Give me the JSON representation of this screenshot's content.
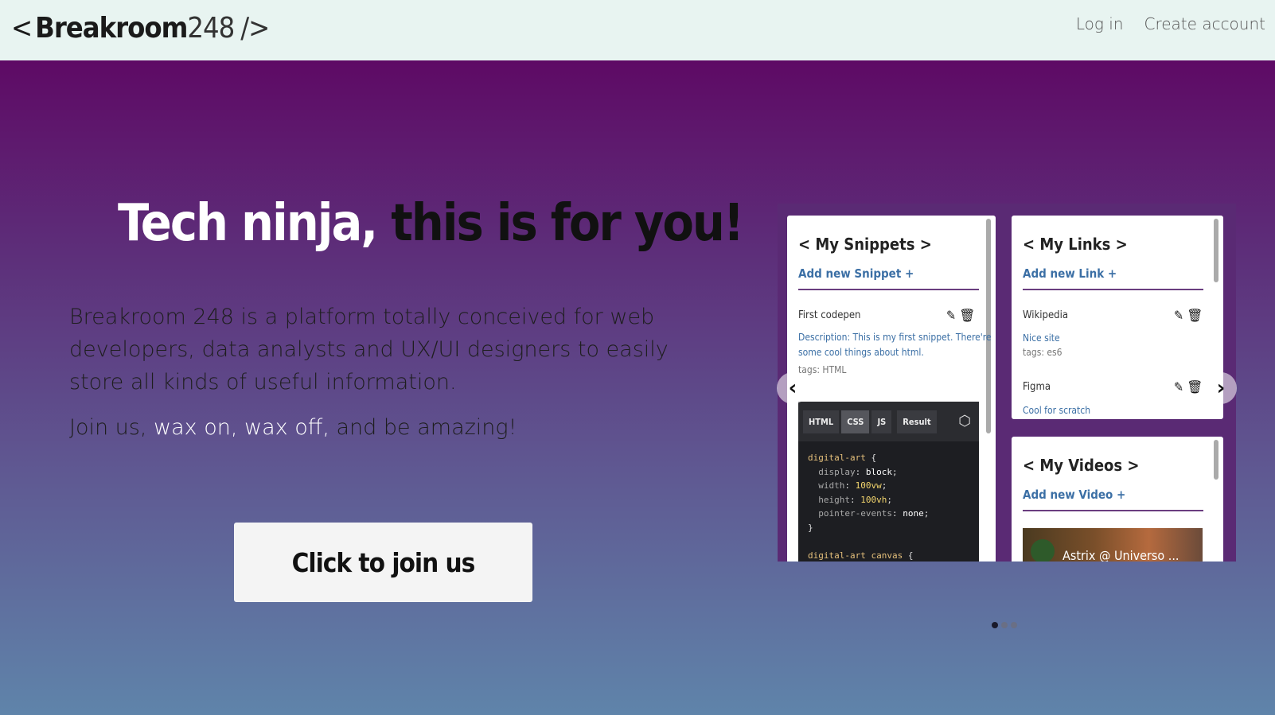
{
  "header": {
    "logo_open": "<",
    "logo_brand": "Breakroom",
    "logo_num": "248",
    "logo_close": "/>",
    "nav": {
      "login": "Log in",
      "create": "Create account"
    }
  },
  "hero": {
    "headline_white": "Tech ninja,",
    "headline_dark": "this is for you!",
    "description": "Breakroom 248 is a platform totally conceived for web developers, data analysts and UX/UI designers to easily store all kinds of useful information.",
    "slogan_1": "Join us, ",
    "slogan_hl": "wax on, wax off,",
    "slogan_2": " and be amazing!",
    "cta": "Click to join us"
  },
  "carousel": {
    "prev": "‹",
    "next": "›",
    "slides_count": 3,
    "active_slide": 1,
    "snippets": {
      "title": "< My Snippets >",
      "add": "Add new Snippet +",
      "item_title": "First codepen",
      "item_desc_1": "Description: This is my first snippet. There're",
      "item_desc_2": "some cool things about html.",
      "item_tags": "tags: HTML",
      "tabs": [
        "HTML",
        "CSS",
        "JS",
        "Result"
      ]
    },
    "links": {
      "title": "< My Links >",
      "add": "Add new Link +",
      "item1_title": "Wikipedia",
      "item1_desc": "Nice site",
      "item1_tags": "tags: es6",
      "item2_title": "Figma",
      "item2_desc": "Cool for scratch"
    },
    "videos": {
      "title": "< My Videos >",
      "add": "Add new Video +",
      "video_title": "Astrix @ Universo ..."
    }
  },
  "colors": {
    "accent_link": "#3b6fa5",
    "gradient_top": "#5e0a65",
    "gradient_bottom": "#5f84aa"
  }
}
